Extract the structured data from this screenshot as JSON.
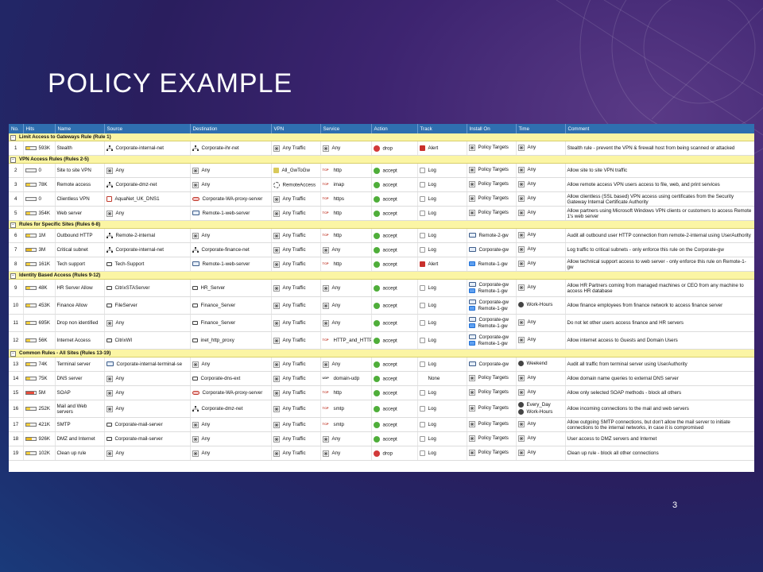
{
  "slide": {
    "title": "POLICY EXAMPLE",
    "page_number": "3"
  },
  "table": {
    "columns": [
      "No.",
      "Hits",
      "Name",
      "Source",
      "Destination",
      "VPN",
      "Service",
      "Action",
      "Track",
      "Install On",
      "Time",
      "Comment"
    ],
    "sections": [
      {
        "label": "Limit Access to Gateways Rule   (Rule 1)",
        "rules": [
          {
            "no": "1",
            "hits": "593K",
            "hit_level": "low",
            "name": "Stealth",
            "source": "Corporate-internal-net",
            "source_icon": "network-icon",
            "destination": "Corporate-ihr-net",
            "destination_icon": "network-icon",
            "vpn": "Any Traffic",
            "service": "Any",
            "service_icon": "any-icon",
            "action": "drop",
            "track": "Alert",
            "install_on": [
              "Policy Targets"
            ],
            "time": [
              "Any"
            ],
            "comment": "Stealth rule - prevent the VPN & firewall host from being scanned or attacked"
          }
        ]
      },
      {
        "label": "VPN Access Rules   (Rules 2-5)",
        "rules": [
          {
            "no": "2",
            "hits": "0",
            "hit_level": "zero",
            "name": "Site to site VPN",
            "source": "Any",
            "source_icon": "any-icon",
            "destination": "Any",
            "destination_icon": "any-icon",
            "vpn": "All_GwToGw",
            "vpn_icon": "vpn-community-icon",
            "service": "http",
            "service_icon": "tcp-icon",
            "action": "accept",
            "track": "Log",
            "install_on": [
              "Policy Targets"
            ],
            "time": [
              "Any"
            ],
            "comment": "Allow site to site VPN traffic"
          },
          {
            "no": "3",
            "hits": "78K",
            "hit_level": "low",
            "name": "Remote access",
            "source": "Corporate-dmz-net",
            "source_icon": "network-icon",
            "destination": "Any",
            "destination_icon": "any-icon",
            "vpn": "RemoteAccess",
            "vpn_icon": "remote-access-icon",
            "service": "imap",
            "service_icon": "tcp-icon",
            "action": "accept",
            "track": "Log",
            "install_on": [
              "Policy Targets"
            ],
            "time": [
              "Any"
            ],
            "comment": "Allow remote access VPN users access to file, web, and print services"
          },
          {
            "no": "4",
            "hits": "0",
            "hit_level": "zero",
            "name": "Clientless VPN",
            "source": "AquaNet_UK_DNS1",
            "source_icon": "host-icon",
            "destination": "Corporate-WA-proxy-server",
            "destination_icon": "proxy-icon",
            "vpn": "Any Traffic",
            "service": "https",
            "service_icon": "tcp-icon",
            "action": "accept",
            "track": "Log",
            "install_on": [
              "Policy Targets"
            ],
            "time": [
              "Any"
            ],
            "comment": "Allow clientless (SSL based) VPN access using certificates from the Security Gateway Internal Certificate Authority"
          },
          {
            "no": "5",
            "hits": "354K",
            "hit_level": "low",
            "name": "Web server",
            "source": "Any",
            "source_icon": "any-icon",
            "destination": "Remote-1-web-server",
            "destination_icon": "gateway-icon",
            "vpn": "Any Traffic",
            "service": "http",
            "service_icon": "tcp-icon",
            "action": "accept",
            "track": "Log",
            "install_on": [
              "Policy Targets"
            ],
            "time": [
              "Any"
            ],
            "comment": "Allow partners using Microsoft Windows VPN clients or customers to access Remote 1's web server"
          }
        ]
      },
      {
        "label": "Rules for Specific Sites   (Rules 6-8)",
        "rules": [
          {
            "no": "6",
            "hits": "1M",
            "hit_level": "low",
            "name": "Outbound HTTP",
            "source": "Remote-2-internal",
            "source_icon": "network-icon",
            "destination": "Any",
            "destination_icon": "any-icon",
            "vpn": "Any Traffic",
            "service": "http",
            "service_icon": "tcp-icon",
            "action": "accept",
            "track": "Log",
            "install_on": [
              "Remote-2-gw"
            ],
            "install_icons": [
              "gateway-icon"
            ],
            "time": [
              "Any"
            ],
            "comment": "Audit all outbound user HTTP connection from remote-2-internal using UserAuthority"
          },
          {
            "no": "7",
            "hits": "3M",
            "hit_level": "med",
            "name": "Critical subnet",
            "source": "Corporate-internal-net",
            "source_icon": "network-icon",
            "destination": "Corporate-finance-net",
            "destination_icon": "network-icon",
            "vpn": "Any Traffic",
            "service": "Any",
            "service_icon": "any-icon",
            "action": "accept",
            "track": "Log",
            "install_on": [
              "Corporate-gw"
            ],
            "install_icons": [
              "gateway-icon"
            ],
            "time": [
              "Any"
            ],
            "comment": "Log traffic to critical subnets - only enforce this rule on the Corporate-gw"
          },
          {
            "no": "8",
            "hits": "161K",
            "hit_level": "low",
            "name": "Tech support",
            "source": "Tech-Support",
            "source_icon": "server-icon",
            "destination": "Remote-1-web-server",
            "destination_icon": "gateway-icon",
            "vpn": "Any Traffic",
            "service": "http",
            "service_icon": "tcp-icon",
            "action": "accept",
            "track": "Alert",
            "install_on": [
              "Remote-1-gw"
            ],
            "install_icons": [
              "firewall-icon"
            ],
            "time": [
              "Any"
            ],
            "comment": "Allow technical support access to web server - only enforce this rule on Remote-1-gw"
          }
        ]
      },
      {
        "label": "Identity Based Access   (Rules 9-12)",
        "rules": [
          {
            "no": "9",
            "hits": "48K",
            "hit_level": "low",
            "name": "HR Server Allow",
            "source": "CitrixSTAServer",
            "source_icon": "server-icon",
            "destination": "HR_Server",
            "destination_icon": "server-icon",
            "vpn": "Any Traffic",
            "service": "Any",
            "service_icon": "any-icon",
            "action": "accept",
            "track": "Log",
            "install_on": [
              "Corporate-gw",
              "Remote-1-gw"
            ],
            "install_icons": [
              "gateway-icon",
              "firewall-icon"
            ],
            "time": [
              "Any"
            ],
            "comment": "Allow HR Partners coming from managed machines or CEO from any machine to access HR database"
          },
          {
            "no": "10",
            "hits": "453K",
            "hit_level": "low",
            "name": "Finance Allow",
            "source": "FileServer",
            "source_icon": "server-icon",
            "destination": "Finance_Server",
            "destination_icon": "server-icon",
            "vpn": "Any Traffic",
            "service": "Any",
            "service_icon": "any-icon",
            "action": "accept",
            "track": "Log",
            "install_on": [
              "Corporate-gw",
              "Remote-1-gw"
            ],
            "install_icons": [
              "gateway-icon",
              "firewall-icon"
            ],
            "time": [
              "Work-Hours"
            ],
            "time_icons": [
              "clock-icon"
            ],
            "comment": "Allow finance employees from finance network to access finance server"
          },
          {
            "no": "11",
            "hits": "695K",
            "hit_level": "low",
            "name": "Drop non identified",
            "source": "Any",
            "source_icon": "any-icon",
            "destination": "Finance_Server",
            "destination_icon": "server-icon",
            "vpn": "Any Traffic",
            "service": "Any",
            "service_icon": "any-icon",
            "action": "accept",
            "track": "Log",
            "install_on": [
              "Corporate-gw",
              "Remote-1-gw"
            ],
            "install_icons": [
              "gateway-icon",
              "firewall-icon"
            ],
            "time": [
              "Any"
            ],
            "comment": "Do not let other users access finance and HR servers"
          },
          {
            "no": "12",
            "hits": "56K",
            "hit_level": "low",
            "name": "Internet Access",
            "source": "CitrixWI",
            "source_icon": "server-icon",
            "destination": "inet_http_proxy",
            "destination_icon": "server-icon",
            "vpn": "Any Traffic",
            "service": "HTTP_and_HTTP",
            "service_icon": "tcp-icon",
            "action": "accept",
            "track": "Log",
            "install_on": [
              "Corporate-gw",
              "Remote-1-gw"
            ],
            "install_icons": [
              "gateway-icon",
              "firewall-icon"
            ],
            "time": [
              "Any"
            ],
            "comment": "Allow internet access to Guests and Domain Users"
          }
        ]
      },
      {
        "label": "Common Rules - All Sites   (Rules 13-19)",
        "rules": [
          {
            "no": "13",
            "hits": "74K",
            "hit_level": "low",
            "name": "Terminal server",
            "source": "Corporate-internal-terminal-se",
            "source_icon": "gateway-icon",
            "destination": "Any",
            "destination_icon": "any-icon",
            "vpn": "Any Traffic",
            "service": "Any",
            "service_icon": "any-icon",
            "action": "accept",
            "track": "Log",
            "install_on": [
              "Corporate-gw"
            ],
            "install_icons": [
              "gateway-icon"
            ],
            "time": [
              "Weekend"
            ],
            "time_icons": [
              "clock-icon"
            ],
            "comment": "Audit all traffic from terminal server using UserAuthority"
          },
          {
            "no": "14",
            "hits": "75K",
            "hit_level": "low",
            "name": "DNS server",
            "source": "Any",
            "source_icon": "any-icon",
            "destination": "Corporate-dns-ext",
            "destination_icon": "server-icon",
            "vpn": "Any Traffic",
            "service": "domain-udp",
            "service_icon": "udp-icon",
            "action": "accept",
            "track": "None",
            "install_on": [
              "Policy Targets"
            ],
            "time": [
              "Any"
            ],
            "comment": "Allow domain name queries to external DNS server"
          },
          {
            "no": "15",
            "hits": "5M",
            "hit_level": "high",
            "name": "SOAP",
            "source": "Any",
            "source_icon": "any-icon",
            "destination": "Corporate-WA-proxy-server",
            "destination_icon": "proxy-icon",
            "vpn": "Any Traffic",
            "service": "http",
            "service_icon": "tcp-icon",
            "action": "accept",
            "track": "Log",
            "install_on": [
              "Policy Targets"
            ],
            "time": [
              "Any"
            ],
            "comment": "Allow only selected SOAP methods - block all others"
          },
          {
            "no": "16",
            "hits": "252K",
            "hit_level": "low",
            "name": "Mail and Web servers",
            "source": "Any",
            "source_icon": "any-icon",
            "destination": "Corporate-dmz-net",
            "destination_icon": "network-icon",
            "vpn": "Any Traffic",
            "service": "smtp",
            "service_icon": "tcp-icon",
            "action": "accept",
            "track": "Log",
            "install_on": [
              "Policy Targets"
            ],
            "time": [
              "Every_Day",
              "Work-Hours"
            ],
            "time_icons": [
              "clock-icon",
              "clock-icon"
            ],
            "comment": "Allow incoming connections to the mail and web servers"
          },
          {
            "no": "17",
            "hits": "421K",
            "hit_level": "low",
            "name": "SMTP",
            "source": "Corporate-mail-server",
            "source_icon": "server-icon",
            "destination": "Any",
            "destination_icon": "any-icon",
            "vpn": "Any Traffic",
            "service": "smtp",
            "service_icon": "tcp-icon",
            "action": "accept",
            "track": "Log",
            "install_on": [
              "Policy Targets"
            ],
            "time": [
              "Any"
            ],
            "comment": "Allow outgoing SMTP connections, but don't allow the mail server to initiate connections to the internal networks, in case it is compromised"
          },
          {
            "no": "18",
            "hits": "926K",
            "hit_level": "med",
            "name": "DMZ and Internet",
            "source": "Corporate-mail-server",
            "source_icon": "server-icon",
            "destination": "Any",
            "destination_icon": "any-icon",
            "vpn": "Any Traffic",
            "service": "Any",
            "service_icon": "any-icon",
            "action": "accept",
            "track": "Log",
            "install_on": [
              "Policy Targets"
            ],
            "time": [
              "Any"
            ],
            "comment": "User access to DMZ servers and Internet"
          },
          {
            "no": "19",
            "hits": "102K",
            "hit_level": "low",
            "name": "Clean up rule",
            "source": "Any",
            "source_icon": "any-icon",
            "destination": "Any",
            "destination_icon": "any-icon",
            "vpn": "Any Traffic",
            "service": "Any",
            "service_icon": "any-icon",
            "action": "drop",
            "track": "Log",
            "install_on": [
              "Policy Targets"
            ],
            "time": [
              "Any"
            ],
            "comment": "Clean up rule - block all other connections"
          }
        ]
      }
    ]
  },
  "colors": {
    "header": "#2f6fb0",
    "section": "#fbf5a4",
    "accept": "#4fae3a",
    "drop": "#d23a3a",
    "alert": "#c9302c"
  }
}
